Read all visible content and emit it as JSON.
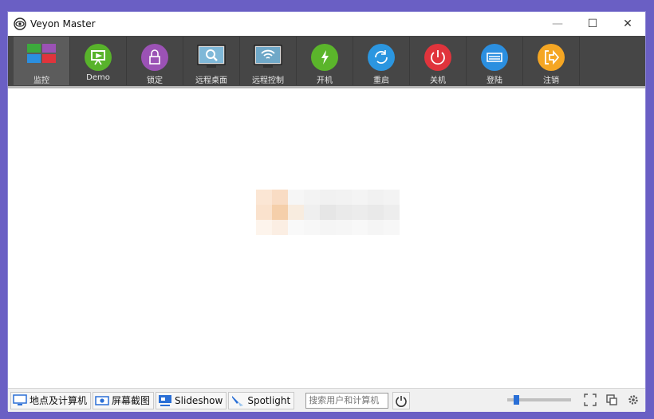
{
  "window": {
    "title": "Veyon Master",
    "minimize": "—",
    "maximize": "☐",
    "close": "✕"
  },
  "toolbar": {
    "items": [
      {
        "label": "监控",
        "icon": "monitor-grid-icon"
      },
      {
        "label": "Demo",
        "icon": "demo-presentation-icon",
        "color": "#58b32b"
      },
      {
        "label": "锁定",
        "icon": "lock-icon",
        "color": "#9b52b5"
      },
      {
        "label": "远程桌面",
        "icon": "remote-view-icon"
      },
      {
        "label": "远程控制",
        "icon": "remote-control-icon"
      },
      {
        "label": "开机",
        "icon": "power-on-icon",
        "color": "#5bb52b"
      },
      {
        "label": "重启",
        "icon": "reboot-icon",
        "color": "#2b96e0"
      },
      {
        "label": "关机",
        "icon": "power-off-icon",
        "color": "#e0343c"
      },
      {
        "label": "登陆",
        "icon": "login-icon",
        "color": "#2b8fe0"
      },
      {
        "label": "注销",
        "icon": "logout-icon",
        "color": "#f5a623"
      }
    ]
  },
  "statusbar": {
    "locations": "地点及计算机",
    "screenshots": "屏幕截图",
    "slideshow": "Slideshow",
    "spotlight": "Spotlight",
    "search_placeholder": "搜索用户和计算机"
  },
  "colors": {
    "accent": "#2a6fd6",
    "toolbar_bg": "#464646",
    "background": "#6a5fc4"
  }
}
